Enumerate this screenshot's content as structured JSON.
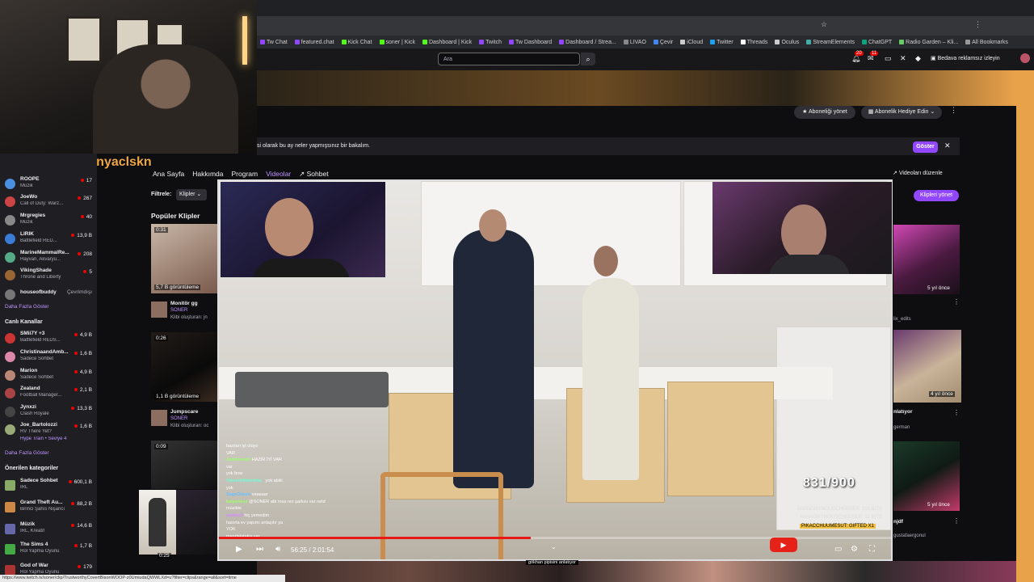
{
  "webcam": {
    "subscriber_label": "Son Abone: dunyaclskn"
  },
  "browser": {
    "bookmarks": [
      "Tw Chat",
      "featured.chat",
      "Kick Chat",
      "soner | Kick",
      "Dashboard | Kick",
      "Twitch",
      "Tw Dashboard",
      "Dashboard / Strea...",
      "LIVAO",
      "Çevir",
      "iCloud",
      "Twitter",
      "Threads",
      "Oculus",
      "StreamElements",
      "ChatGPT",
      "Radio Garden – Kli...",
      "All Bookmarks"
    ],
    "status_url": "https://www.twitch.tv/soner/clip/TrustworthyCovertBisonWOOP-z0UmiudaQWWLXd=u?filter=clips&range=all&sort=time"
  },
  "twitch_nav": {
    "search_placeholder": "Ara",
    "notif_count": "20",
    "inbox_count": "11",
    "ad_free_label": "Bedava reklamsız izleyin"
  },
  "banner": {
    "manage_sub": "Aboneliği yönet",
    "gift_sub": "Abonelik Hediye Edin"
  },
  "notice": {
    "text": "si olarak bu ay neler yapmışsınız bir bakalım.",
    "button": "Göster"
  },
  "sidebar": {
    "followed": [
      {
        "name": "ROOPE",
        "game": "Müzik",
        "viewers": "17",
        "color": "#4a90e2"
      },
      {
        "name": "JoeWo",
        "game": "Call of Duty: Warz...",
        "viewers": "267",
        "color": "#c44"
      },
      {
        "name": "Mrgregies",
        "game": "Müzik",
        "viewers": "40",
        "color": "#888"
      },
      {
        "name": "LIRIK",
        "game": "Battlefield RED...",
        "viewers": "13,9 B",
        "color": "#3a7bd5"
      },
      {
        "name": "MarineMammalRe...",
        "game": "Hayvan, Akvaryu...",
        "viewers": "208",
        "color": "#5a8"
      },
      {
        "name": "VikingShade",
        "game": "Throne and Liberty",
        "viewers": "5",
        "color": "#963"
      },
      {
        "name": "houseofbuddy",
        "game": "",
        "viewers": "Çevrimdışı",
        "color": "#777"
      }
    ],
    "more_1": "Daha Fazla Göster",
    "live_heading": "Canlı Kanallar",
    "live": [
      {
        "name": "SMii7Y +3",
        "game": "Battlefield REDS...",
        "viewers": "4,9 B",
        "color": "#c33"
      },
      {
        "name": "ChristinaandAmb...",
        "game": "Sadece Sohbet",
        "viewers": "1,6 B",
        "color": "#d8a"
      },
      {
        "name": "Marion",
        "game": "Sadece Sohbet",
        "viewers": "4,9 B",
        "color": "#b87"
      },
      {
        "name": "Zealand",
        "game": "Football Manager...",
        "viewers": "2,1 B",
        "color": "#a44"
      },
      {
        "name": "Jynxzi",
        "game": "Clash Royale",
        "viewers": "13,3 B",
        "color": "#444"
      },
      {
        "name": "Joe_Bartolozzi",
        "game": "RV There Yet?",
        "viewers": "1,6 B",
        "color": "#9a7"
      }
    ],
    "hype_train": "Hype Train • Seviye 4",
    "more_2": "Daha Fazla Göster",
    "cat_heading": "Önerilen kategoriler",
    "categories": [
      {
        "name": "Sadece Sohbet",
        "sub": "IRL",
        "viewers": "600,1 B",
        "color": "#8a6"
      },
      {
        "name": "Grand Theft Au...",
        "sub": "Birinci Şahıs Nişancı",
        "viewers": "88,2 B",
        "color": "#c84"
      },
      {
        "name": "Müzik",
        "sub": "IRL, Kreatif",
        "viewers": "14,6 B",
        "color": "#66a"
      },
      {
        "name": "The Sims 4",
        "sub": "Rol Yapma Oyunu",
        "viewers": "1,7 B",
        "color": "#4a4"
      },
      {
        "name": "God of War",
        "sub": "Rol Yapma Oyunu",
        "viewers": "179",
        "color": "#a33"
      }
    ]
  },
  "main": {
    "tabs": [
      "Ana Sayfa",
      "Hakkımda",
      "Program",
      "Videolar",
      "Sohbet"
    ],
    "filter_label": "Filtrele:",
    "filter_value": "Klipler",
    "popular_heading": "Popüler Klipler",
    "manage_videos": "Videoları düzenle",
    "manage_clips": "Klipleri yönet",
    "clips": [
      {
        "duration": "0:31",
        "views": "5,7 B görüntüleme",
        "title": "Monitör gg",
        "channel": "SONER",
        "by": "Klibi oluşturan: jn"
      },
      {
        "duration": "0:26",
        "views": "1,1 B görüntüleme",
        "title": "Jumpscare",
        "channel": "SONER",
        "by": "Klibi oluşturan: oc"
      },
      {
        "duration": "0:09",
        "views": "",
        "title": "",
        "channel": "",
        "by": ""
      },
      {
        "duration": "0:25",
        "views": "",
        "title": "",
        "channel": "",
        "by": ""
      }
    ],
    "right_items": [
      {
        "age": "5 yıl önce",
        "sub": "lix_edits"
      },
      {
        "age": "4 yıl önce",
        "title": "nlatıyor",
        "sub": "german"
      },
      {
        "age": "5 yıl önce",
        "title": "njdf",
        "sub": "gustafaergonul"
      }
    ]
  },
  "player": {
    "counter": "831/900",
    "bits_1": "ANANONYMOUSCHEERER: 100 BITS",
    "bits_2": "ANANONYMOUSCHEERER: 12 BITS",
    "gifted": "PIKACCHUUMESUT: GIFTED X1",
    "time": "56:25 / 2:01:54",
    "caption": "gökhan pipisini anlatıyor",
    "chat": [
      {
        "u": "",
        "m": "bazıları iyi oluyo"
      },
      {
        "u": "",
        "m": "VAR"
      },
      {
        "u": "Zambinow1",
        "m": "HAZIR İYİ VAR"
      },
      {
        "u": "",
        "m": "var"
      },
      {
        "u": "",
        "m": "yok bnw"
      },
      {
        "u": "VincentValentine_",
        "m": "yok abiiii"
      },
      {
        "u": "",
        "m": "yok"
      },
      {
        "u": "SageOdeen",
        "m": "vaaaaar"
      },
      {
        "u": "kalpsbeee",
        "m": "@SONER abi rosa nın şarkısı var netd"
      },
      {
        "u": "",
        "m": "müzikte"
      },
      {
        "u": "xmitos3",
        "m": "hiç yemedim"
      },
      {
        "u": "",
        "m": "hazırla ev yapımı anlaşılır ya"
      },
      {
        "u": "",
        "m": "YOK"
      },
      {
        "u": "",
        "m": "mandalatakis var"
      }
    ]
  }
}
